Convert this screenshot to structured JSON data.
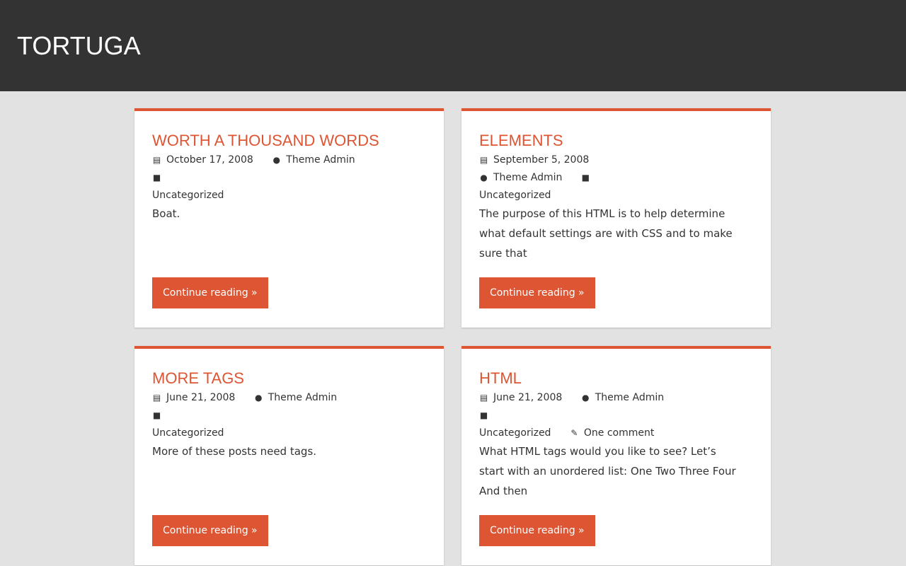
{
  "site": {
    "title": "TORTUGA"
  },
  "posts": [
    {
      "title": "WORTH A THOUSAND WORDS",
      "date": "October 17, 2008",
      "author": "Theme Admin",
      "category": "Uncategorized",
      "comments": "",
      "excerpt": "Boat.",
      "more_label": "Continue reading »"
    },
    {
      "title": "ELEMENTS",
      "date": "September 5, 2008",
      "author": "Theme Admin",
      "category": "Uncategorized",
      "comments": "",
      "excerpt": "The purpose of this HTML is to help determine what default settings are with CSS and to make sure that",
      "more_label": "Continue reading »"
    },
    {
      "title": "MORE TAGS",
      "date": "June 21, 2008",
      "author": "Theme Admin",
      "category": "Uncategorized",
      "comments": "",
      "excerpt": "More of these posts need tags.",
      "more_label": "Continue reading »"
    },
    {
      "title": "HTML",
      "date": "June 21, 2008",
      "author": "Theme Admin",
      "category": "Uncategorized",
      "comments": "One comment",
      "excerpt": "What HTML tags would you like to see? Let’s start with an unordered list: One Two Three Four And then",
      "more_label": "Continue reading »"
    }
  ],
  "icons": {
    "date": "calendar-icon",
    "author": "user-icon",
    "category": "folder-icon",
    "comments": "pencil-icon"
  },
  "colors": {
    "header_bg": "#333333",
    "page_bg": "#e2e2e2",
    "accent": "#dd5533",
    "text": "#333333",
    "card_bg": "#ffffff"
  }
}
